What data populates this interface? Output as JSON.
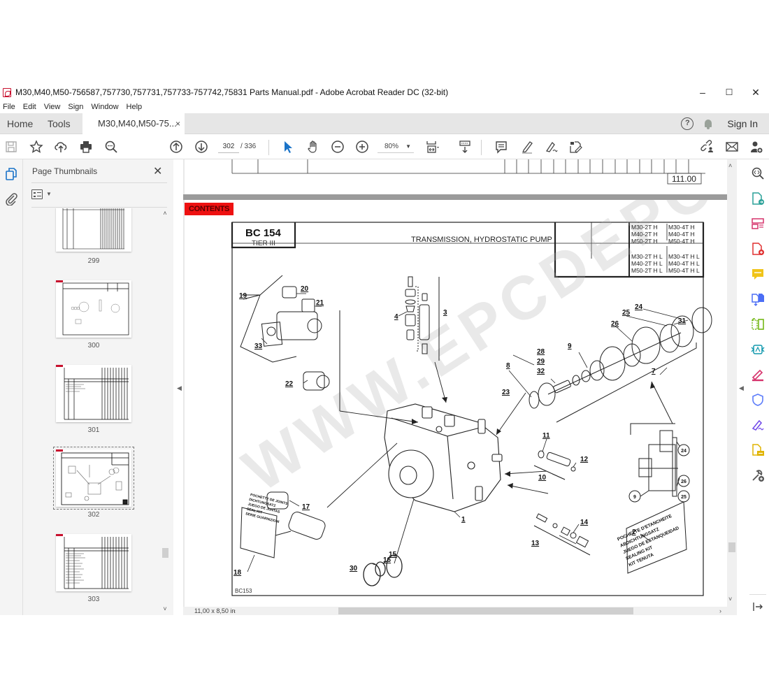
{
  "window": {
    "title": "M30,M40,M50-756587,757730,757731,757733-757742,75831  Parts Manual.pdf - Adobe Acrobat Reader DC (32-bit)",
    "controls": {
      "minimize": "–",
      "maximize": "☐",
      "close": "✕"
    }
  },
  "menu": [
    "File",
    "Edit",
    "View",
    "Sign",
    "Window",
    "Help"
  ],
  "tabs": {
    "home": "Home",
    "tools": "Tools",
    "document": "M30,M40,M50-75...",
    "document_close": "×",
    "help": "?",
    "sign_in": "Sign In"
  },
  "toolbar": {
    "current_page": "302",
    "page_total": "/  336",
    "zoom": "80%",
    "icons": [
      "save-icon",
      "bookmark-star-icon",
      "upload-cloud-icon",
      "print-icon",
      "find-icon",
      "page-up-icon",
      "page-down-icon",
      "select-pointer-icon",
      "hand-pan-icon",
      "zoom-out-icon",
      "zoom-in-icon",
      "fit-page-icon",
      "scroll-mode-icon",
      "comment-icon",
      "highlight-pen-icon",
      "fill-sign-icon",
      "edit-pdf-icon",
      "share-link-icon",
      "email-icon",
      "add-user-icon"
    ]
  },
  "thumbnails_panel": {
    "title": "Page Thumbnails",
    "close": "✕",
    "pages": [
      {
        "label": "299",
        "selected": false
      },
      {
        "label": "300",
        "selected": false
      },
      {
        "label": "301",
        "selected": false
      },
      {
        "label": "302",
        "selected": true
      },
      {
        "label": "303",
        "selected": false
      }
    ]
  },
  "document": {
    "prev_page_total": "111.00",
    "contents_button": "CONTENTS",
    "code": "BC 154",
    "tier": "TIER III",
    "section_title": "TRANSMISSION, HYDROSTATIC PUMP",
    "models_top_left": [
      "M30-2T H",
      "M40-2T H",
      "M50-2T H"
    ],
    "models_top_right": [
      "M30-4T H",
      "M40-4T H",
      "M50-4T H"
    ],
    "models_bottom_left": [
      "M30-2T H L",
      "M40-2T H L",
      "M50-2T H L"
    ],
    "models_bottom_right": [
      "M30-4T H L",
      "M40-4T H L",
      "M50-4T H L"
    ],
    "figure_ref": "BC153",
    "callouts": [
      "1",
      "2",
      "3",
      "4",
      "7",
      "8",
      "9",
      "10",
      "11",
      "12",
      "13",
      "14",
      "15",
      "16",
      "17",
      "18",
      "19",
      "20",
      "21",
      "22",
      "23",
      "24",
      "25",
      "26",
      "28",
      "29",
      "30",
      "31",
      "32",
      "33"
    ],
    "detail_callouts": [
      "24",
      "26",
      "25",
      "9"
    ],
    "seal_kit_label_right": [
      "POCHETTE D'ETANCHEITE",
      "ABDICHTUNGSATZ",
      "JUEGO DE ESTANQUEIDAD",
      "SEALING KIT",
      "KIT TENUTA"
    ],
    "seal_kit_label_left": [
      "POCHETTE DE JOINTS",
      "DICHTUNGSATZ",
      "JUEGO DE JUNTAS",
      "SEAL KIT",
      "SERIE GUARNIZIONI"
    ],
    "watermark": "WWW.EPCDEPO.COM"
  },
  "status": {
    "page_size": "11,00 x 8,50 in"
  },
  "colors": {
    "contents_red": "#ee1111",
    "tab_bar": "#e6e6e6",
    "accent_blue": "#1a73c8"
  }
}
